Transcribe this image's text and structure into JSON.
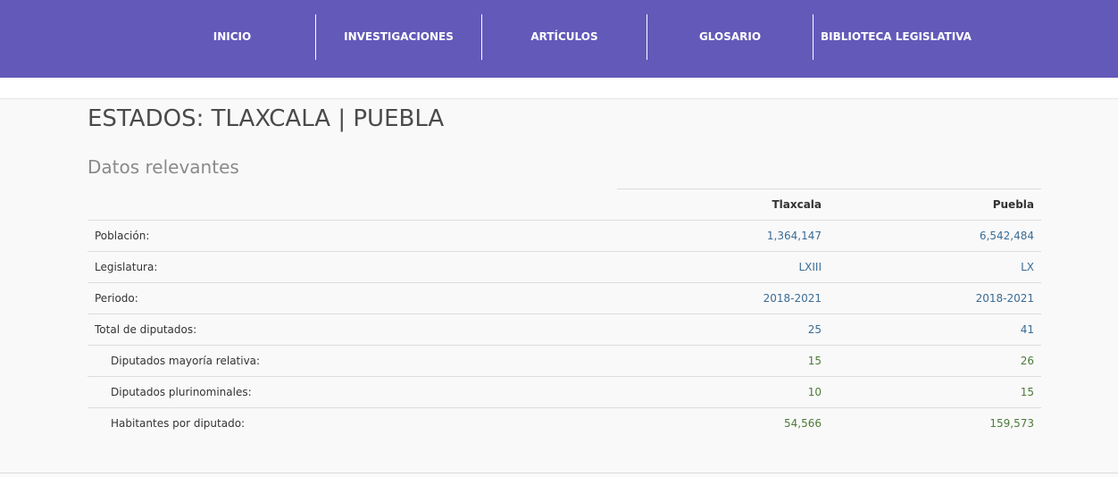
{
  "nav": {
    "items": [
      {
        "label": "INICIO"
      },
      {
        "label": "INVESTIGACIONES"
      },
      {
        "label": "ARTÍCULOS"
      },
      {
        "label": "GLOSARIO"
      },
      {
        "label": "BIBLIOTECA LEGISLATIVA"
      }
    ]
  },
  "page": {
    "title": "ESTADOS: TLAXCALA | PUEBLA",
    "section_title": "Datos relevantes"
  },
  "table": {
    "headers": [
      "",
      "Tlaxcala",
      "Puebla"
    ],
    "rows": [
      {
        "label": "Población:",
        "tlaxcala": "1,364,147",
        "puebla": "6,542,484"
      },
      {
        "label": "Legislatura:",
        "tlaxcala": "LXIII",
        "puebla": "LX"
      },
      {
        "label": "Periodo:",
        "tlaxcala": "2018-2021",
        "puebla": "2018-2021"
      },
      {
        "label": "Total de diputados:",
        "tlaxcala": "25",
        "puebla": "41"
      },
      {
        "label": "Diputados mayoría relativa:",
        "tlaxcala": "15",
        "puebla": "26"
      },
      {
        "label": "Diputados plurinominales:",
        "tlaxcala": "10",
        "puebla": "15"
      },
      {
        "label": "Habitantes por diputado:",
        "tlaxcala": "54,566",
        "puebla": "159,573"
      }
    ]
  },
  "colors": {
    "nav_bg": "#6359b9",
    "value_blue": "#3a6c96",
    "value_green": "#4d7a3a"
  }
}
